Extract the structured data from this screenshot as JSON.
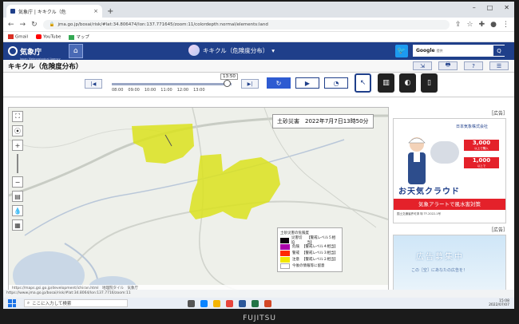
{
  "browser": {
    "tab_title": "気象庁 | キキクル（危",
    "tab_close": "×",
    "new_tab": "+",
    "url": "jma.go.jp/bosai/risk/#lat:34.806474/lon:137.771645/zoom:11/colordepth:normal/elements:land",
    "bookmarks": [
      "Gmail",
      "YouTube",
      "マップ"
    ]
  },
  "jma": {
    "logo_text": "気象庁",
    "logo_sub": "Japan Meteorological Agency",
    "page_title": "キキクル（危険度分布）",
    "search_label": "Google",
    "search_suffix": "提供",
    "search_button": "Q"
  },
  "subbar": {
    "title": "キキクル（危険度分布）"
  },
  "timeline": {
    "current_time": "13:50",
    "ticks": [
      "08:00",
      "09:00",
      "10:00",
      "11:00",
      "12:00",
      "13:00"
    ],
    "prev_label": "|◀",
    "next_label": "▶|",
    "play_label": "▶",
    "refresh_label": "↻",
    "speed_label": "◔",
    "progress": 0.96
  },
  "map": {
    "info": "土砂災害　2022年7月7日13時50分",
    "legend_title": "土砂災害の危険度",
    "legend": [
      {
        "code": "",
        "label": "災害切迫",
        "detail": "【警戒レベル５相当】",
        "color": "#0c000c"
      },
      {
        "code": "",
        "label": "危険",
        "detail": "【警戒レベル４相当】",
        "color": "#aa00aa"
      },
      {
        "code": "",
        "label": "警戒",
        "detail": "【警戒レベル３相当】",
        "color": "#ff2800"
      },
      {
        "code": "",
        "label": "注意",
        "detail": "【警戒レベル２相当】",
        "color": "#f2e700"
      },
      {
        "code": "",
        "label": "今後の情報等に留意",
        "detail": "",
        "color": "#ffffff"
      }
    ],
    "footer": "https://maps.gsi.go.jp/development/ichiran.html　地理院タイル　気象庁"
  },
  "ads": {
    "label": "［広告］",
    "ad1_header": "日本気象株式会社",
    "ad1_box1": "3,000",
    "ad1_box1_unit": "以上で購入",
    "ad1_box2": "1,000",
    "ad1_box2_unit": "以上で",
    "ad1_brand": "お天気クラウド",
    "ad1_strip": "気象アラートで風水害対策",
    "ad1_small": "国土交通省許可済 特 TF-2022-1号",
    "ad2_main": "広告募集中",
    "ad2_sub": "この［空］にあなたの広告を！"
  },
  "status_url": "https://www.jma.go.jp/bosai/risk/#lat:34.8064/lon:137.7716/zoom:11",
  "taskbar": {
    "search": "ここに入力して検索",
    "time": "15:08",
    "date": "2022/07/07"
  },
  "bezel": "FUJITSU",
  "colors": {
    "jma_blue": "#1f3f8a",
    "warning_yellow": "#f2e700"
  }
}
